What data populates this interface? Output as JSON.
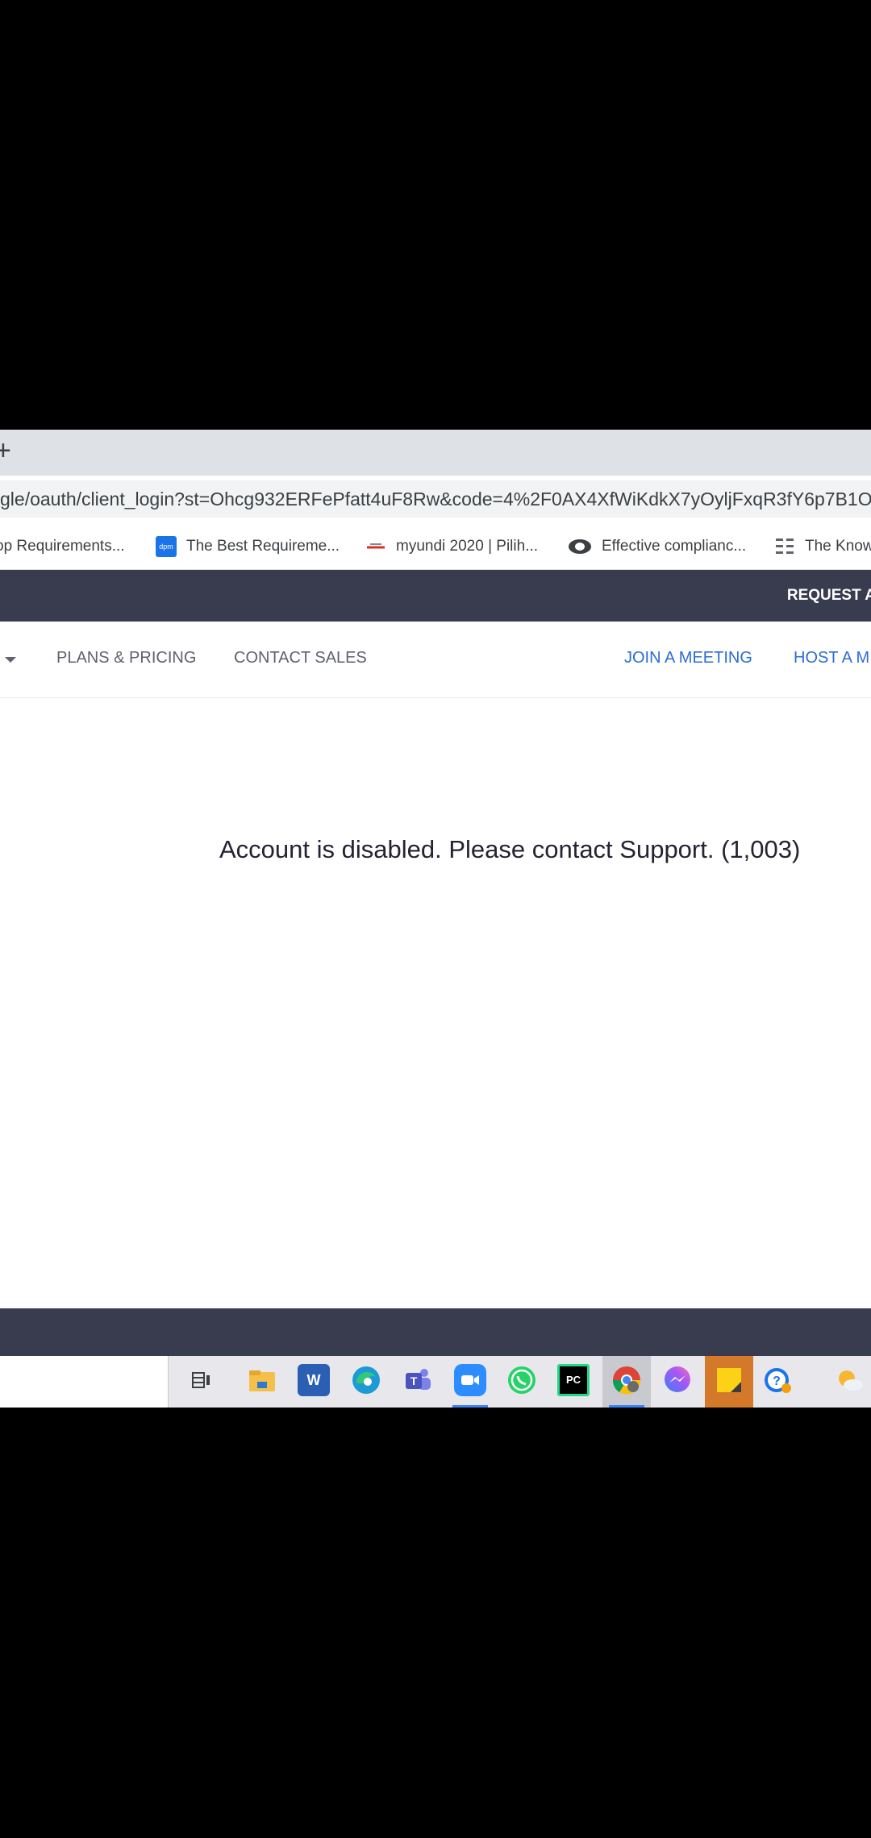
{
  "browser": {
    "new_tab": "+",
    "address": "gle/oauth/client_login?st=Ohcg932ERFePfatt4uF8Rw&code=4%2F0AX4XfWiKdkX7yOyljFxqR3fY6p7B1O",
    "bookmarks": [
      {
        "label": "op Requirements..."
      },
      {
        "label": "The Best Requireme...",
        "icon_text": "dpm"
      },
      {
        "label": "myundi 2020 | Pilih..."
      },
      {
        "label": "Effective complianc..."
      },
      {
        "label": "The Know"
      }
    ]
  },
  "site": {
    "topbar": {
      "request_label": "REQUEST A"
    },
    "nav": {
      "plans_pricing": "PLANS & PRICING",
      "contact_sales": "CONTACT SALES",
      "join_meeting": "JOIN A MEETING",
      "host_meeting": "HOST A M"
    },
    "message": "Account is disabled. Please contact Support. (1,003)",
    "colors": {
      "topbar": "#393c4e",
      "link_blue": "#2d6cd6",
      "text": "#232333"
    }
  },
  "taskbar": {
    "icons": [
      "task-view-icon",
      "file-explorer-icon",
      "word-icon",
      "edge-icon",
      "teams-icon",
      "zoom-icon",
      "whatsapp-icon",
      "pycharm-icon",
      "chrome-icon",
      "messenger-icon",
      "sticky-notes-icon",
      "help-icon",
      "weather-icon"
    ],
    "word_letter": "W",
    "pycharm_letters": "PC"
  }
}
